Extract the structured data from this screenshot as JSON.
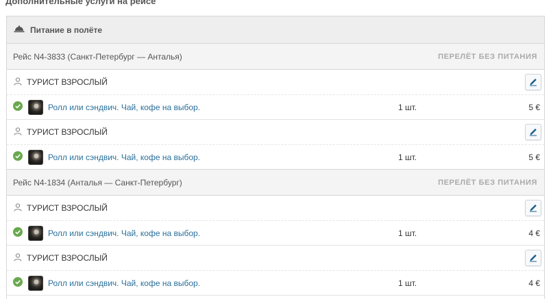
{
  "section_title": "Дополнительные услуги на рейсе",
  "panel": {
    "header_label": "Питание в полёте",
    "header_icon": "cloche-icon"
  },
  "flights": [
    {
      "name": "Рейс N4-3833 (Санкт-Петербург — Анталья)",
      "status": "ПЕРЕЛЁТ БЕЗ ПИТАНИЯ",
      "passengers": [
        {
          "label": "ТУРИСТ ВЗРОСЛЫЙ",
          "meal": "Ролл или сэндвич. Чай, кофе на выбор.",
          "qty": "1 шт.",
          "price": "5 €"
        },
        {
          "label": "ТУРИСТ ВЗРОСЛЫЙ",
          "meal": "Ролл или сэндвич. Чай, кофе на выбор.",
          "qty": "1 шт.",
          "price": "5 €"
        }
      ]
    },
    {
      "name": "Рейс N4-1834 (Анталья — Санкт-Петербург)",
      "status": "ПЕРЕЛЁТ БЕЗ ПИТАНИЯ",
      "passengers": [
        {
          "label": "ТУРИСТ ВЗРОСЛЫЙ",
          "meal": "Ролл или сэндвич. Чай, кофе на выбор.",
          "qty": "1 шт.",
          "price": "4 €"
        },
        {
          "label": "ТУРИСТ ВЗРОСЛЫЙ",
          "meal": "Ролл или сэндвич. Чай, кофе на выбор.",
          "qty": "1 шт.",
          "price": "4 €"
        }
      ]
    }
  ],
  "colors": {
    "check_green": "#6aa84f",
    "link_blue": "#2a6f9a",
    "status_gray": "#aaaaaa",
    "edit_icon_blue": "#1f5f8b"
  }
}
